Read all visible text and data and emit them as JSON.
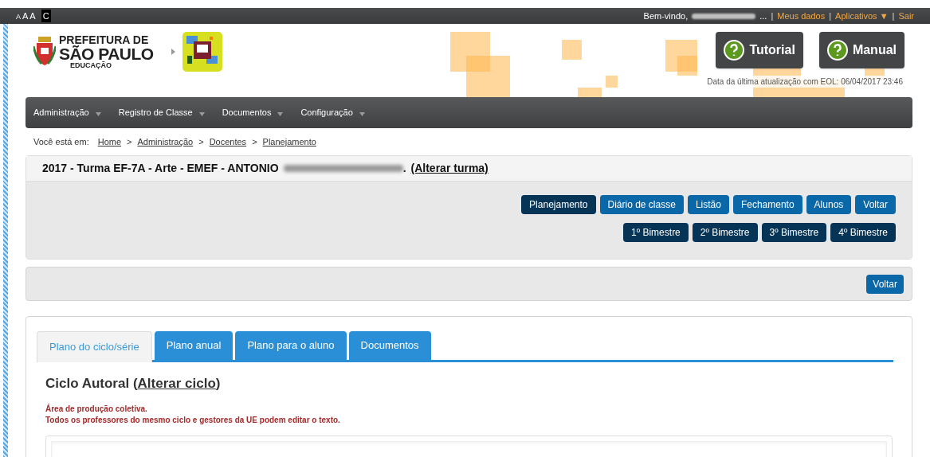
{
  "topbar": {
    "font_sizes": [
      "A",
      "A",
      "A"
    ],
    "contrast": "C",
    "welcome": "Bem-vindo,",
    "ellipsis": "...",
    "separator": "|",
    "links": [
      {
        "label": "Meus dados"
      },
      {
        "label": "Aplicativos ▼"
      },
      {
        "label": "Sair"
      }
    ]
  },
  "header": {
    "logo_lines": [
      "PREFEITURA DE",
      "SÃO PAULO",
      "EDUCAÇÃO"
    ],
    "help_buttons": [
      "Tutorial",
      "Manual"
    ],
    "update_note": "Data da última atualização com EOL: 06/04/2017 23:46"
  },
  "menu": [
    "Administração",
    "Registro de Classe",
    "Documentos",
    "Configuração"
  ],
  "breadcrumb": {
    "label": "Você está em:",
    "separator": ">",
    "items": [
      "Home",
      "Administração",
      "Docentes",
      "Planejamento"
    ]
  },
  "class_panel": {
    "title": "2017 - Turma EF-7A - Arte - EMEF - ANTONIO",
    "title_end": ".",
    "change_link": "(Alterar turma)",
    "actions": [
      {
        "label": "Planejamento",
        "selected": true
      },
      {
        "label": "Diário de classe",
        "selected": false
      },
      {
        "label": "Listão",
        "selected": false
      },
      {
        "label": "Fechamento",
        "selected": false
      },
      {
        "label": "Alunos",
        "selected": false
      },
      {
        "label": "Voltar",
        "selected": false
      }
    ],
    "terms": [
      "1º Bimestre",
      "2º Bimestre",
      "3º Bimestre",
      "4º Bimestre"
    ]
  },
  "back_panel": {
    "button": "Voltar"
  },
  "tabs": [
    {
      "label": "Plano do ciclo/série",
      "selected": true
    },
    {
      "label": "Plano anual",
      "selected": false
    },
    {
      "label": "Plano para o aluno",
      "selected": false
    },
    {
      "label": "Documentos",
      "selected": false
    }
  ],
  "content": {
    "heading": "Ciclo Autoral (",
    "heading_link": "Alterar ciclo",
    "heading_end": ")",
    "notes": [
      "Área de produção coletiva.",
      "Todos os professores do mesmo ciclo e gestores da UE podem editar o texto."
    ]
  }
}
